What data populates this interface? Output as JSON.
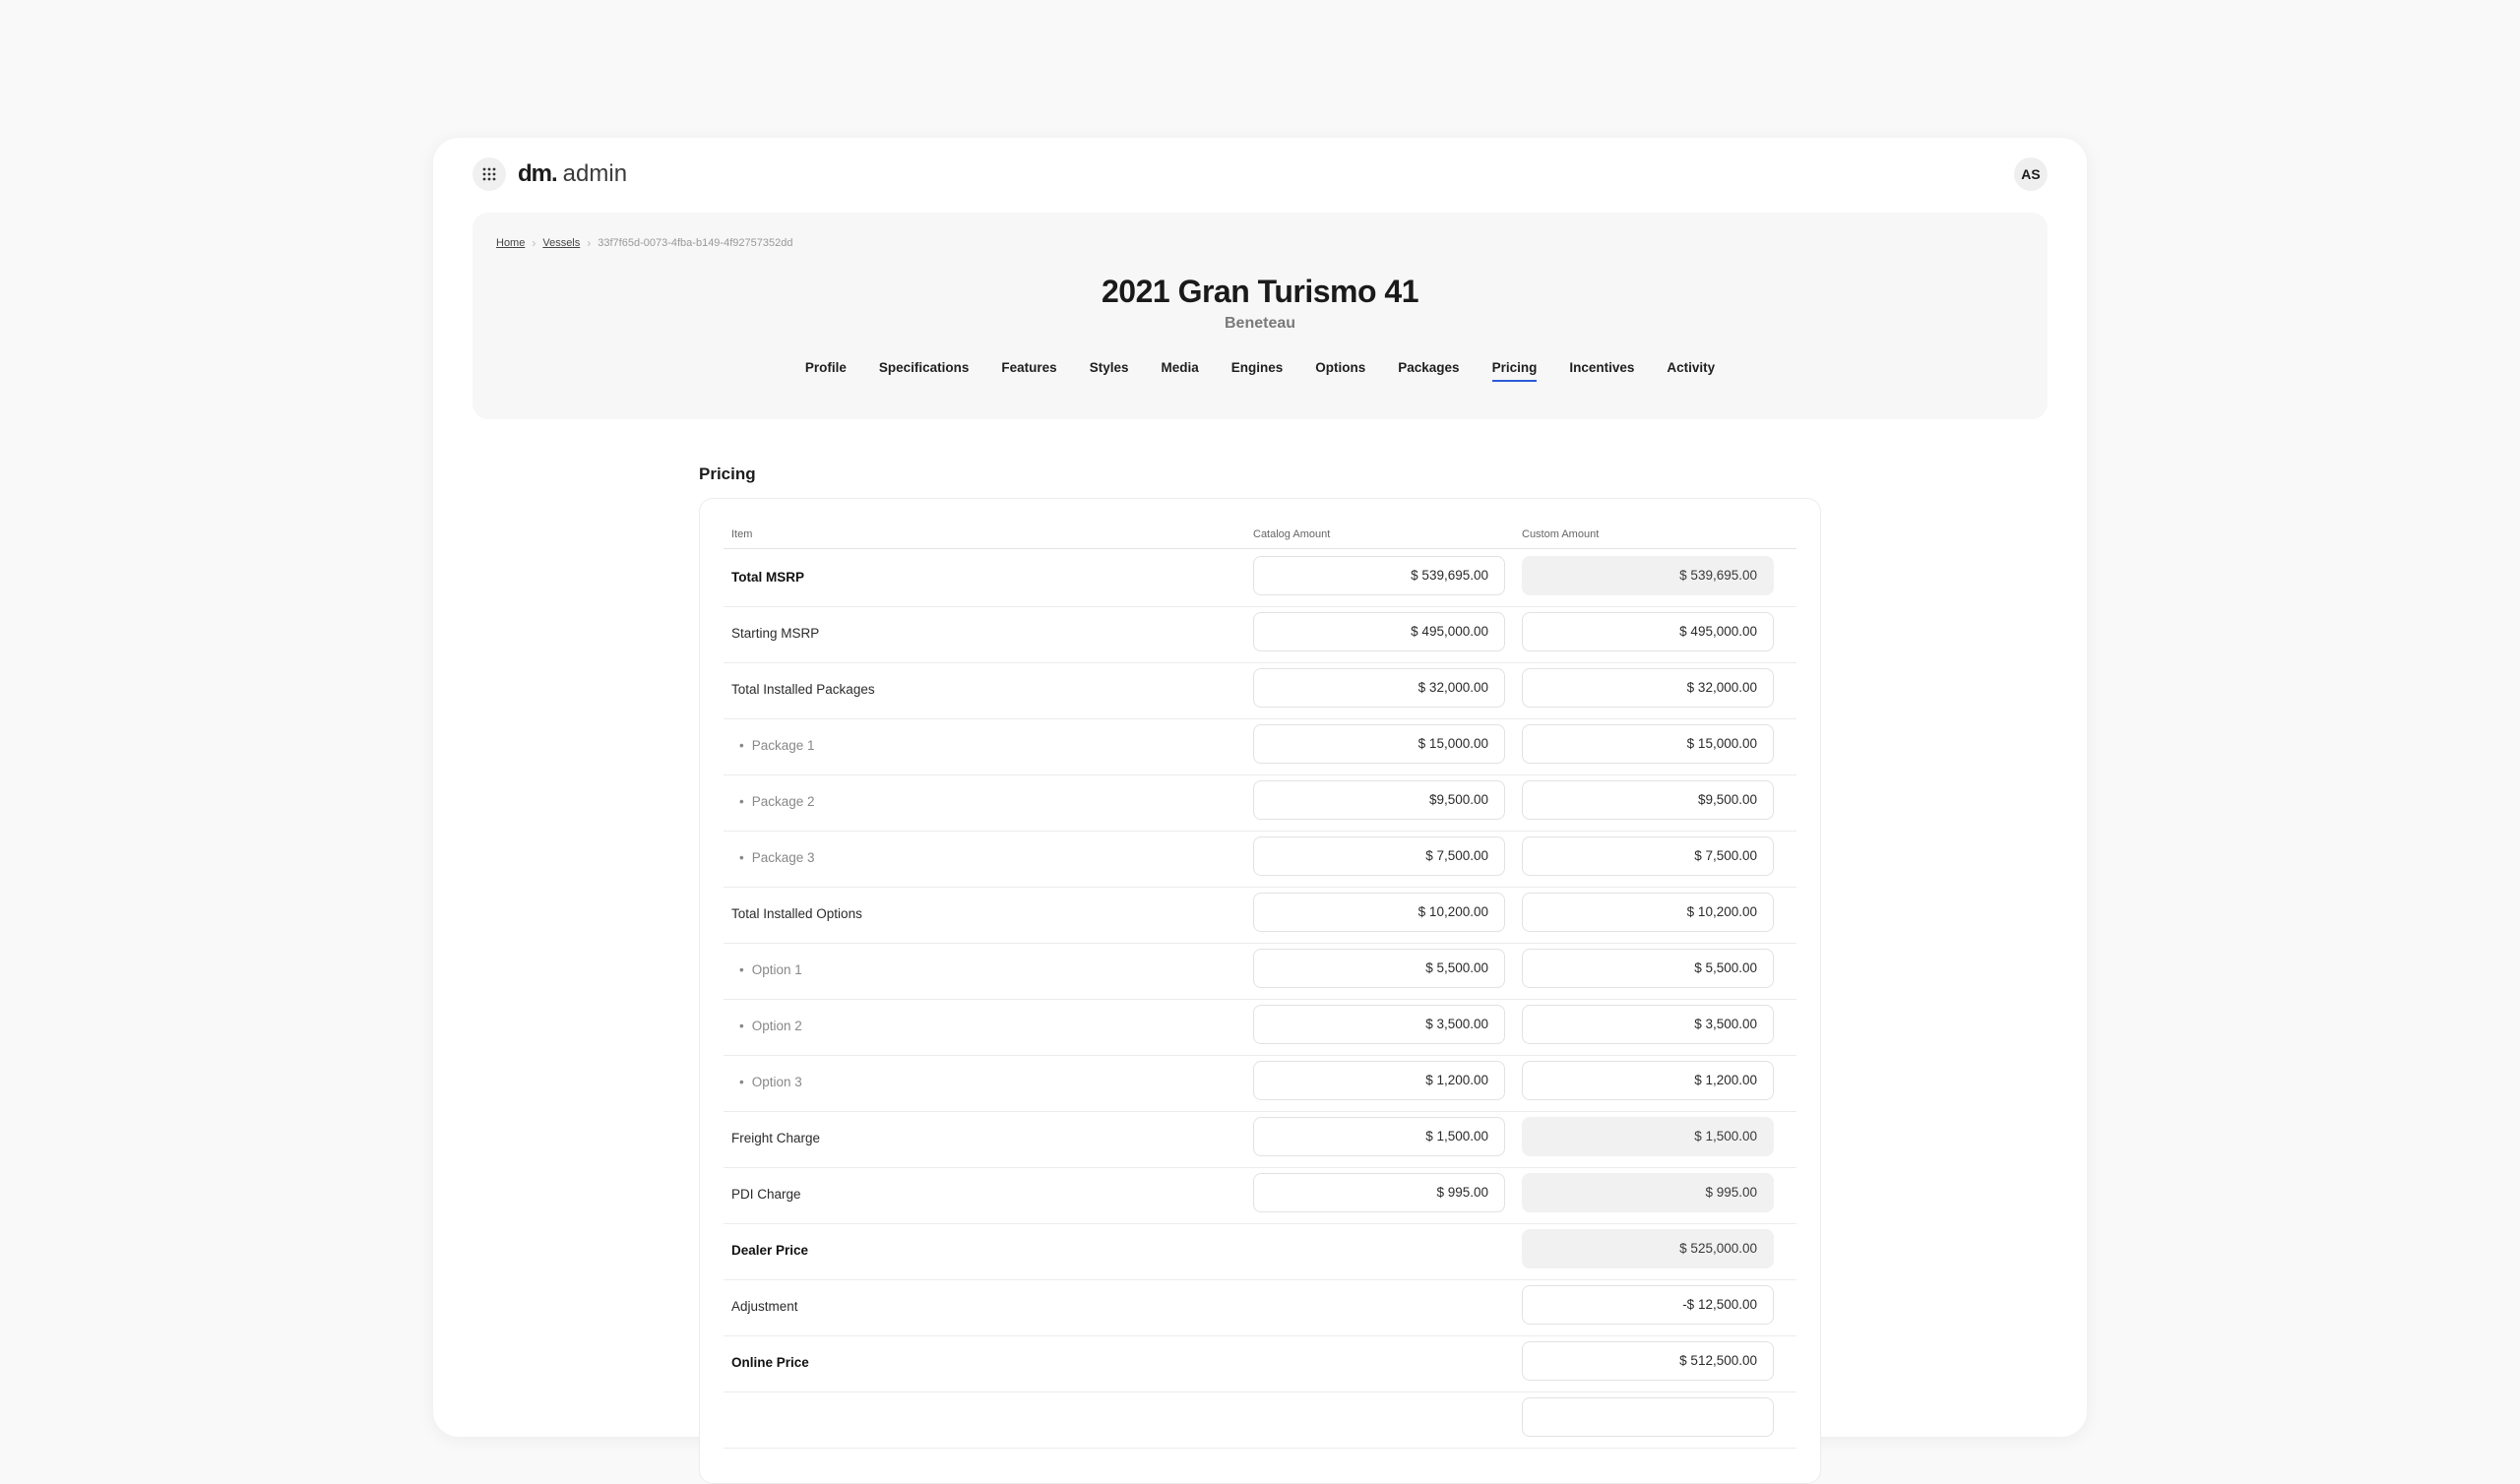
{
  "app": {
    "logo_mark": "dm.",
    "logo_word": "admin",
    "avatar_initials": "AS"
  },
  "breadcrumb": {
    "home": "Home",
    "vessels": "Vessels",
    "current": "33f7f65d-0073-4fba-b149-4f92757352dd"
  },
  "vessel": {
    "title": "2021 Gran Turismo 41",
    "brand": "Beneteau"
  },
  "tabs": [
    "Profile",
    "Specifications",
    "Features",
    "Styles",
    "Media",
    "Engines",
    "Options",
    "Packages",
    "Pricing",
    "Incentives",
    "Activity"
  ],
  "active_tab": "Pricing",
  "pricing": {
    "section_title": "Pricing",
    "columns": {
      "item": "Item",
      "catalog": "Catalog Amount",
      "custom": "Custom Amount"
    },
    "rows": [
      {
        "label": "Total MSRP",
        "style": "bold",
        "catalog": "$ 539,695.00",
        "custom": "$ 539,695.00",
        "custom_readonly": true
      },
      {
        "label": "Starting MSRP",
        "style": "normal",
        "catalog": "$ 495,000.00",
        "custom": "$ 495,000.00",
        "custom_readonly": false
      },
      {
        "label": "Total Installed Packages",
        "style": "normal",
        "catalog": "$ 32,000.00",
        "custom": "$ 32,000.00",
        "custom_readonly": false
      },
      {
        "label": "Package 1",
        "style": "sub",
        "catalog": "$ 15,000.00",
        "custom": "$ 15,000.00",
        "custom_readonly": false
      },
      {
        "label": "Package 2",
        "style": "sub",
        "catalog": "$9,500.00",
        "custom": "$9,500.00",
        "custom_readonly": false
      },
      {
        "label": "Package 3",
        "style": "sub",
        "catalog": "$ 7,500.00",
        "custom": "$ 7,500.00",
        "custom_readonly": false
      },
      {
        "label": "Total Installed Options",
        "style": "normal",
        "catalog": "$ 10,200.00",
        "custom": "$ 10,200.00",
        "custom_readonly": false
      },
      {
        "label": "Option 1",
        "style": "sub",
        "catalog": "$ 5,500.00",
        "custom": "$ 5,500.00",
        "custom_readonly": false
      },
      {
        "label": "Option 2",
        "style": "sub",
        "catalog": "$ 3,500.00",
        "custom": "$ 3,500.00",
        "custom_readonly": false
      },
      {
        "label": "Option 3",
        "style": "sub",
        "catalog": "$ 1,200.00",
        "custom": "$ 1,200.00",
        "custom_readonly": false
      },
      {
        "label": "Freight Charge",
        "style": "normal",
        "catalog": "$ 1,500.00",
        "custom": "$ 1,500.00",
        "custom_readonly": true
      },
      {
        "label": "PDI Charge",
        "style": "normal",
        "catalog": "$ 995.00",
        "custom": "$ 995.00",
        "custom_readonly": true
      },
      {
        "label": "Dealer Price",
        "style": "bold",
        "catalog": null,
        "custom": "$ 525,000.00",
        "custom_readonly": true
      },
      {
        "label": "Adjustment",
        "style": "normal",
        "catalog": null,
        "custom": "-$ 12,500.00",
        "custom_readonly": false
      },
      {
        "label": "Online Price",
        "style": "bold",
        "catalog": null,
        "custom": "$ 512,500.00",
        "custom_readonly": false
      },
      {
        "label": "",
        "style": "normal",
        "catalog": null,
        "custom": "",
        "custom_readonly": false
      }
    ]
  },
  "colors": {
    "accent": "#2a5bd7",
    "background": "#f9f9f9",
    "readonly_field": "#f1f1f1"
  },
  "icons": {
    "app_menu": "grid-dots-icon"
  }
}
